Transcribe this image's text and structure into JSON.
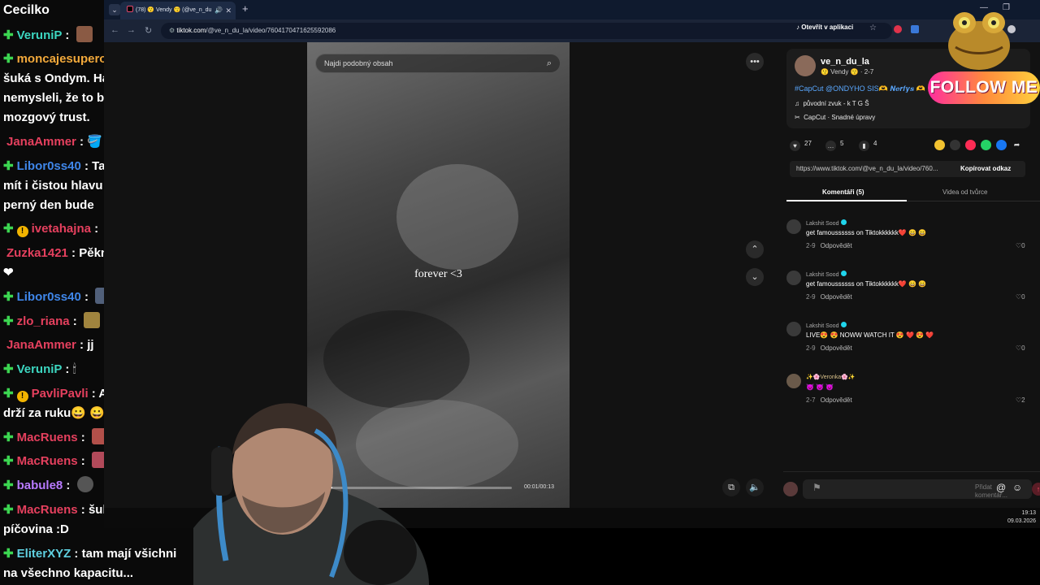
{
  "chat": {
    "header": "Cecilko",
    "messages": [
      {
        "user": "VeruniP",
        "color": "#3cd6c0",
        "sub": true,
        "text": ""
      },
      {
        "user": "moncajesuperok",
        "color": "#f2a93b",
        "sub": true,
        "text": "Dobre, tak šuká s Ondym. Hádam ste si nemysleli, že to bude nejaký mozgový trust."
      },
      {
        "user": "JanaAmmer",
        "color": "#e5405e",
        "sub": false,
        "text": "🪣 🪣 🪣"
      },
      {
        "user": "Libor0ss40",
        "color": "#3f86e8",
        "sub": true,
        "text": "Tak za potřebí mít i čistou hlavu 👍 ☺ 🤣asi perný den bude"
      },
      {
        "user": "ivetahajna",
        "color": "#e5405e",
        "sub": true,
        "badge": "!",
        "text": ""
      },
      {
        "user": "Zuzka1421",
        "color": "#e5405e",
        "sub": false,
        "text": "Pěkný večer všem ❤"
      },
      {
        "user": "Libor0ss40",
        "color": "#3f86e8",
        "sub": true,
        "text": ""
      },
      {
        "user": "zlo_riana",
        "color": "#e5405e",
        "sub": true,
        "text": ""
      },
      {
        "user": "JanaAmmer",
        "color": "#e5405e",
        "sub": false,
        "text": "jj"
      },
      {
        "user": "VeruniP",
        "color": "#3cd6c0",
        "sub": true,
        "text": "🕯"
      },
      {
        "user": "PavliPavli",
        "color": "#e5405e",
        "sub": true,
        "badge": "!",
        "text": "A s adelou se drží za ruku😀 😀"
      },
      {
        "user": "MacRuens",
        "color": "#e5405e",
        "sub": true,
        "text": ""
      },
      {
        "user": "MacRuens",
        "color": "#e5405e",
        "sub": true,
        "text": ""
      },
      {
        "user": "babule8",
        "color": "#b87aff",
        "sub": true,
        "text": ""
      },
      {
        "user": "MacRuens",
        "color": "#e5405e",
        "sub": true,
        "text": "šuká není píčovina :D"
      },
      {
        "user": "EliterXYZ",
        "color": "#5fd0e0",
        "sub": true,
        "text": "tam mají všichni na všechno kapacitu..."
      }
    ]
  },
  "browser": {
    "tab_title": "(78) 😗 Vendy 😗 (@ve_n_du",
    "url_host": "tiktok.com",
    "url_path": "/@ve_n_du_la/video/7604170471625592086",
    "open_in_app": "Otevřít v aplikaci"
  },
  "video": {
    "search_placeholder": "Najdi podobný obsah",
    "caption": "forever <3",
    "time": "00:01/00:13",
    "progress": 0.08
  },
  "panel": {
    "username": "ve_n_du_la",
    "nickname": "😗 Vendy 😗 · 2-7",
    "description": "#CapCut @ONDYHO SIS🫶 𝑵𝒆𝒓𝒇𝒚𝒔 🫶",
    "sound": "původní zvuk - k T G Š",
    "capcut": "CapCut · Snadné úpravy",
    "likes": "27",
    "comments_count": "5",
    "saves": "4",
    "link_url": "https://www.tiktok.com/@ve_n_du_la/video/760...",
    "copy_link": "Kopírovat odkaz",
    "tab_comments": "Komentáři (5)",
    "tab_creator": "Videa od tvůrce",
    "comment_placeholder": "Přidat komentář...",
    "colors": {
      "accent": "#fe2c55",
      "link": "#5aa8ff"
    }
  },
  "comments": [
    {
      "user": "Lakshit Sood",
      "text": "get famoussssss on Tiktokkkkkk❤️ 😄 😄",
      "date": "2-9",
      "reply": "Odpovědět",
      "likes": "0"
    },
    {
      "user": "Lakshit Sood",
      "text": "get famoussssss on Tiktokkkkkk❤️ 😄 😄",
      "date": "2-9",
      "reply": "Odpovědět",
      "likes": "0"
    },
    {
      "user": "Lakshit Sood",
      "text": "LIVE😍 😍 NOWW WATCH IT 😍 ❤️ 😍 ❤️",
      "date": "2-9",
      "reply": "Odpovědět",
      "likes": "0"
    },
    {
      "user": "✨🌸Veronka🌸✨",
      "text": "😈 😈 😈",
      "date": "2-7",
      "reply": "Odpovědět",
      "likes": "2"
    }
  ],
  "clock": {
    "time": "19:13",
    "date": "09.03.2026"
  },
  "overlay": {
    "follow": "FOLLOW ME"
  }
}
